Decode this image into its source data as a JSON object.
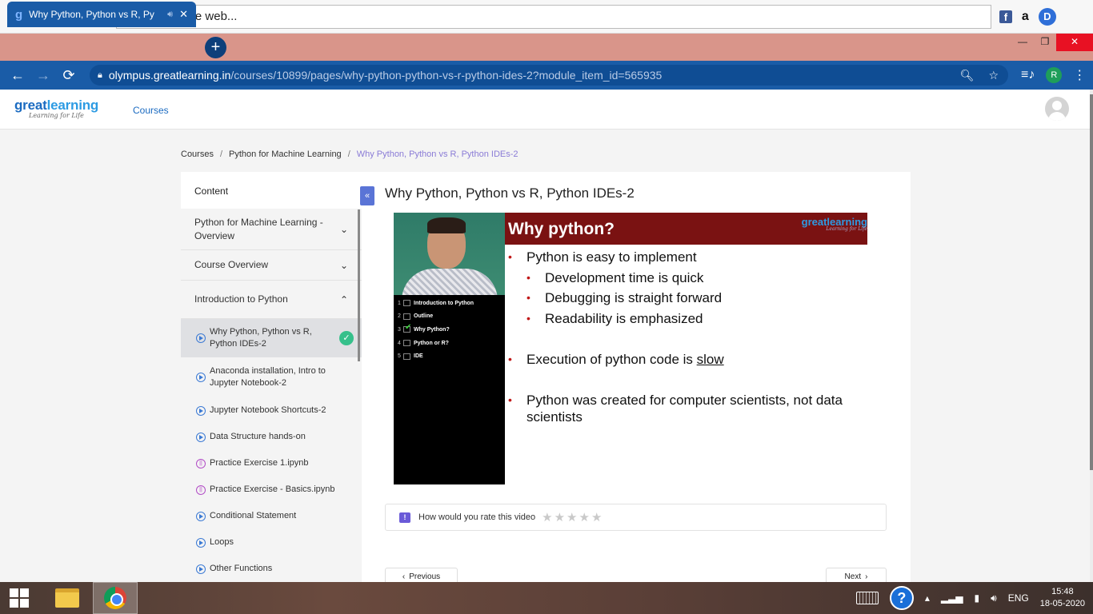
{
  "topbar": {
    "search_placeholder": "Search the web...",
    "icons": [
      "back-icon",
      "forward-icon",
      "reload-icon",
      "chrome-icon",
      "facebook-icon",
      "amazon-icon",
      "d-icon"
    ]
  },
  "browser": {
    "tab_title": "Why Python, Python vs R, Py",
    "url_domain": "olympus.greatlearning.in",
    "url_path": "/courses/10899/pages/why-python-python-vs-r-python-ides-2?module_item_id=565935",
    "profile_letter": "R"
  },
  "site": {
    "logo_main_1": "great",
    "logo_main_2": "learning",
    "logo_tagline": "Learning for Life",
    "nav_courses": "Courses"
  },
  "breadcrumb": [
    "Courses",
    "Python for Machine Learning",
    "Why Python, Python vs R, Python IDEs-2"
  ],
  "sidebar": {
    "header": "Content",
    "sections": [
      {
        "label": "Python for Machine Learning - Overview",
        "expanded": false
      },
      {
        "label": "Course Overview",
        "expanded": false
      },
      {
        "label": "Introduction to Python",
        "expanded": true
      }
    ],
    "items": [
      {
        "label": "Why Python, Python vs R, Python IDEs-2",
        "type": "video",
        "active": true,
        "completed": true
      },
      {
        "label": "Anaconda installation, Intro to Jupyter Notebook-2",
        "type": "video"
      },
      {
        "label": "Jupyter Notebook Shortcuts-2",
        "type": "video"
      },
      {
        "label": "Data Structure hands-on",
        "type": "video"
      },
      {
        "label": "Practice Exercise 1.ipynb",
        "type": "notebook"
      },
      {
        "label": "Practice Exercise - Basics.ipynb",
        "type": "notebook"
      },
      {
        "label": "Conditional Statement",
        "type": "video"
      },
      {
        "label": "Loops",
        "type": "video"
      },
      {
        "label": "Other Functions",
        "type": "video"
      }
    ]
  },
  "main": {
    "title": "Why Python, Python vs R, Python IDEs-2",
    "video": {
      "slide_title": "Why python?",
      "slide_logo": "greatlearning",
      "slide_logo_tag": "Learning for Life",
      "toc": [
        {
          "num": "1",
          "label": "Introduction to Python",
          "checked": false
        },
        {
          "num": "2",
          "label": "Outline",
          "checked": false
        },
        {
          "num": "3",
          "label": "Why Python?",
          "checked": true
        },
        {
          "num": "4",
          "label": "Python or R?",
          "checked": false
        },
        {
          "num": "5",
          "label": "IDE",
          "checked": false
        }
      ],
      "bullets": {
        "b1": "Python is easy to implement",
        "b1a": "Development time is quick",
        "b1b": "Debugging is straight forward",
        "b1c": "Readability is emphasized",
        "b2_pre": "Execution of python code is ",
        "b2_under": "slow",
        "b3": "Python was created for computer scientists, not data scientists"
      }
    },
    "rating_prompt": "How would you rate this video",
    "rating_stars": 0,
    "prev_label": "Previous",
    "next_label": "Next"
  },
  "taskbar": {
    "lang": "ENG",
    "time": "15:48",
    "date": "18-05-2020"
  }
}
